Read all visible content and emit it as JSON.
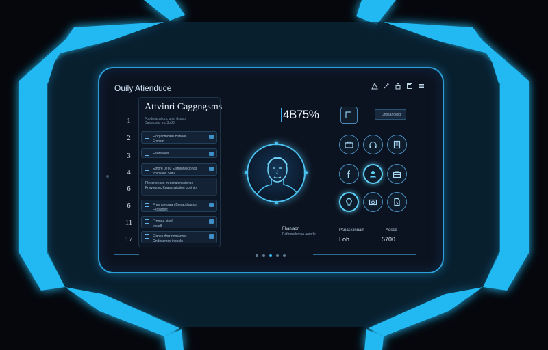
{
  "app": {
    "title": "Ouily Atienduce"
  },
  "toolbar": {
    "icons": [
      "triangle-icon",
      "pen-icon",
      "lock-icon",
      "save-icon",
      "menu-icon"
    ]
  },
  "left_panel": {
    "title": "Attvinri Caggngsms",
    "subtitle_line1": "Fgodmacaj dnc gnst dsgsp",
    "subtitle_line2": "Dajaaoxisl fnc 3b83",
    "row_numbers": [
      "1",
      "2",
      "3",
      "4",
      "6",
      "6",
      "11",
      "17"
    ],
    "items": [
      {
        "text": "Floqutomoaall Bsnoor",
        "subtext": "Frsosm"
      },
      {
        "text": "Faotakoos",
        "subtext": ""
      },
      {
        "text": "Etnore 0760 Elsmioniocioncs",
        "subtext": "Irniovaolt Suni"
      },
      {
        "text": "Fleesnoncsn mrdcnaionssionoe",
        "subtext": "Frivvsnoec Knaosnatotion uceinio"
      },
      {
        "text": "Fresnonesaan Bunaodsamsn",
        "subtext": "Fessaoeit"
      },
      {
        "text": "Frnntaa ciosl",
        "subtext": "Inscdl"
      },
      {
        "text": "Elanes dorr nornaorns",
        "subtext": "Ondnssmos inooclo"
      }
    ]
  },
  "middle_panel": {
    "stat_value": "4B75%",
    "face_label": "Fhanlaon",
    "face_sub": "Pafmesdomsa aamrlet"
  },
  "right_panel": {
    "top_button_label": "Dnbsarioesd",
    "icons": [
      "briefcase-icon",
      "headphones-icon",
      "book-icon",
      "facebook-icon",
      "user-icon",
      "bag-icon",
      "lightbulb-icon",
      "camera-icon",
      "document-icon"
    ],
    "active_icons": [
      "user-icon",
      "lightbulb-icon"
    ],
    "footer_label_left": "Psnasklinuam",
    "footer_value_left": "Loh",
    "footer_label_right": "Adsse",
    "footer_value_right": "5700"
  },
  "pagination": {
    "dot_count": 5,
    "active_dot": 2
  },
  "colors": {
    "accent": "#2fc4ff",
    "panel": "#0c1320",
    "background": "#05070c"
  }
}
